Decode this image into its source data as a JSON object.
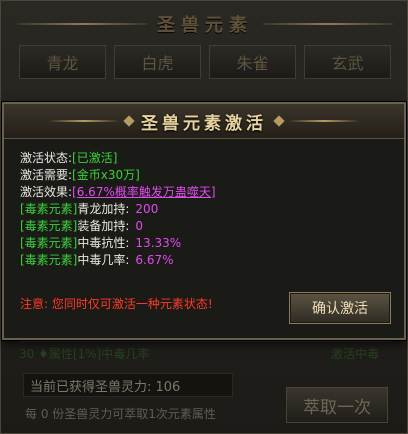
{
  "background": {
    "title": "圣兽元素",
    "tabs": [
      "青龙",
      "白虎",
      "朱雀",
      "玄武"
    ],
    "dim_row_left": "30 ♦属性[1%]中毒几率",
    "dim_row_right": "激活中毒",
    "gained_label": "当前已获得圣兽灵力: 106",
    "exchange_note": "每 0 份圣兽灵力可萃取1次元素属性",
    "extract_button": "萃取一次"
  },
  "dialog": {
    "title": "圣兽元素激活",
    "status_label": "激活状态:",
    "status_value": "[已激活]",
    "cost_label": "激活需要:",
    "cost_value": "[金币x30万]",
    "effect_label": "激活效果:",
    "effect_value": "[6.67%概率触发万蛊噬天]",
    "stats": [
      {
        "tag": "[毒素元素]",
        "name": "青龙加持:",
        "value": "200"
      },
      {
        "tag": "[毒素元素]",
        "name": "装备加持:",
        "value": "0"
      },
      {
        "tag": "[毒素元素]",
        "name": "中毒抗性:",
        "value": "13.33%"
      },
      {
        "tag": "[毒素元素]",
        "name": "中毒几率:",
        "value": "6.67%"
      }
    ],
    "warning": "注意: 您同时仅可激活一种元素状态!",
    "confirm_button": "确认激活"
  },
  "colors": {
    "green": "#3ad13a",
    "purple": "#e04bf0",
    "warning": "#ff3a2a",
    "title_gold": "#e8d2a0"
  }
}
